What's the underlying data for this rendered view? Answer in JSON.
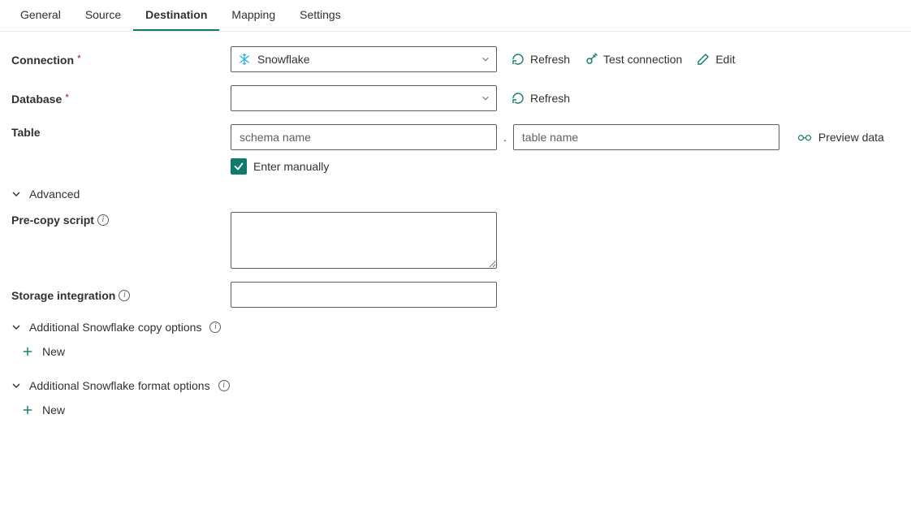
{
  "tabs": {
    "general": "General",
    "source": "Source",
    "destination": "Destination",
    "mapping": "Mapping",
    "settings": "Settings"
  },
  "labels": {
    "connection": "Connection",
    "database": "Database",
    "table": "Table",
    "pre_copy": "Pre-copy script",
    "storage_integration": "Storage integration",
    "advanced": "Advanced",
    "copy_options": "Additional Snowflake copy options",
    "format_options": "Additional Snowflake format options",
    "enter_manually": "Enter manually"
  },
  "fields": {
    "connection_value": "Snowflake",
    "database_value": "",
    "schema_placeholder": "schema name",
    "table_placeholder": "table name",
    "pre_copy_value": "",
    "storage_integration_value": ""
  },
  "actions": {
    "refresh": "Refresh",
    "test_connection": "Test connection",
    "edit": "Edit",
    "preview_data": "Preview data",
    "new": "New"
  }
}
